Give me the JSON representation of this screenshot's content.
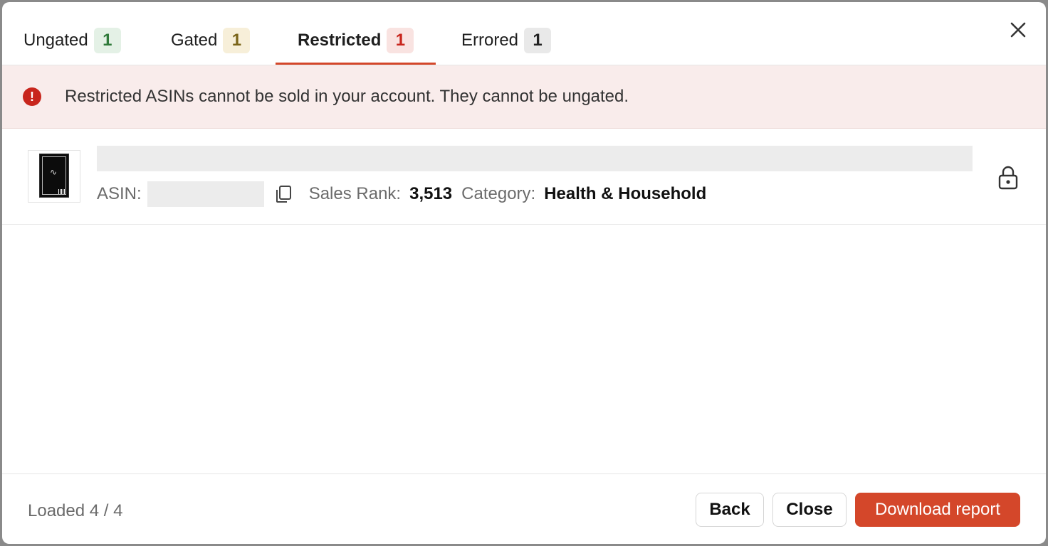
{
  "tabs": [
    {
      "label": "Ungated",
      "count": "1",
      "badge_bg": "#e4f1e6",
      "badge_fg": "#2f7a3a"
    },
    {
      "label": "Gated",
      "count": "1",
      "badge_bg": "#f7efd9",
      "badge_fg": "#7a6418"
    },
    {
      "label": "Restricted",
      "count": "1",
      "badge_bg": "#f9e3e1",
      "badge_fg": "#c8261d"
    },
    {
      "label": "Errored",
      "count": "1",
      "badge_bg": "#e9e9e9",
      "badge_fg": "#222222"
    }
  ],
  "active_tab": "Restricted",
  "banner": {
    "text": "Restricted ASINs cannot be sold in your account. They cannot be ungated.",
    "icon": "alert-circle-icon",
    "icon_glyph": "!"
  },
  "item": {
    "asin_label": "ASIN:",
    "sales_rank_label": "Sales Rank:",
    "sales_rank": "3,513",
    "category_label": "Category:",
    "category": "Health & Household",
    "status_icon": "lock-icon"
  },
  "footer": {
    "loaded_text": "Loaded 4 / 4",
    "back_label": "Back",
    "close_label": "Close",
    "download_label": "Download report"
  },
  "colors": {
    "accent": "#d4472a",
    "banner_bg": "#f9eceb",
    "alert": "#c8261d"
  }
}
